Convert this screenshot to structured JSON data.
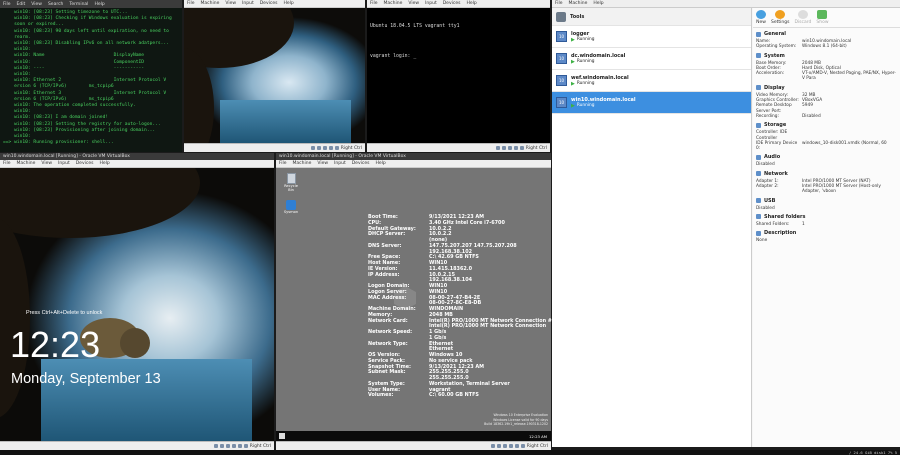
{
  "left_terminal": {
    "titlebar": "",
    "menu": [
      "File",
      "Edit",
      "View",
      "Search",
      "Terminal",
      "Help"
    ],
    "lines": [
      "    win10: [08:23] Setting timezone to UTC...",
      "    win10: [08:23] Checking if Windows evaluation is expiring",
      "    soon or expired...",
      "    win10: [08:23] 90 days left until expiration, no need to",
      "    rearm.",
      "    win10: [08:23] Disabling IPv6 on all network adatpers...",
      "    win10:",
      "    win10: Name                         DisplayName",
      "    win10:                              ComponentID",
      "    win10: ----                         -----------",
      "    win10:",
      "    win10: Ethernet 2                   Internet Protocol V",
      "    ersion 6 (TCP/IPv6)        ms_tcpip6",
      "    win10: Ethernet 3                   Internet Protocol V",
      "    ersion 6 (TCP/IPv6)        ms_tcpip6",
      "    win10: The operation completed successfully.",
      "    win10:",
      "    win10: [08:23] I am domain joined!",
      "    win10: [08:23] Setting the registry for auto-logon...",
      "    win10: [08:23] Provisioning after joining domain...",
      "    win10:",
      "==> win10: Running provisioner: shell..."
    ]
  },
  "top_vm1": {
    "menu": [
      "File",
      "Machine",
      "View",
      "Input",
      "Devices",
      "Help"
    ],
    "status": "Right Ctrl"
  },
  "top_vm2": {
    "menu": [
      "File",
      "Machine",
      "View",
      "Input",
      "Devices",
      "Help"
    ],
    "status": "Right Ctrl",
    "console": [
      "Ubuntu 18.04.5 LTS vagrant tty1",
      "",
      "vagrant login: _"
    ]
  },
  "bl_vm": {
    "titlebar": "win10.windomain.local [Running] - Oracle VM VirtualBox",
    "menu": [
      "File",
      "Machine",
      "View",
      "Input",
      "Devices",
      "Help"
    ],
    "unlock_hint": "Press Ctrl+Alt+Delete to unlock",
    "time": "12:23",
    "date": "Monday, September 13",
    "status": "Right Ctrl"
  },
  "bm_vm": {
    "titlebar": "win10.windomain.local [Running] - Oracle VM VirtualBox",
    "menu": [
      "File",
      "Machine",
      "View",
      "Input",
      "Devices",
      "Help"
    ],
    "status": "Right Ctrl",
    "desktop_icons": [
      "Recycle Bin",
      "Sysmon"
    ],
    "bginfo": [
      [
        "Boot Time:",
        "9/13/2021 12:23 AM"
      ],
      [
        "CPU:",
        "3.40 GHz Intel Core i7-6700"
      ],
      [
        "Default Gateway:",
        "10.0.2.2"
      ],
      [
        "DHCP Server:",
        "10.0.2.2"
      ],
      [
        "",
        "(none)"
      ],
      [
        "DNS Server:",
        "147.75.207.207 147.75.207.208"
      ],
      [
        "",
        "192.168.38.102"
      ],
      [
        "Free Space:",
        "C:\\ 42.69 GB NTFS"
      ],
      [
        "Host Name:",
        "WIN10"
      ],
      [
        "IE Version:",
        "11.415.18362.0"
      ],
      [
        "IP Address:",
        "10.0.2.15"
      ],
      [
        "",
        "192.168.38.104"
      ],
      [
        "Logon Domain:",
        "WIN10"
      ],
      [
        "Logon Server:",
        "WIN10"
      ],
      [
        "MAC Address:",
        "08-00-27-47-B4-2E"
      ],
      [
        "",
        "08-00-27-8C-E8-DB"
      ],
      [
        "Machine Domain:",
        "WINDOMAIN"
      ],
      [
        "Memory:",
        "2048 MB"
      ],
      [
        "Network Card:",
        "Intel(R) PRO/1000 MT Network Connection #2"
      ],
      [
        "",
        "Intel(R) PRO/1000 MT Network Connection"
      ],
      [
        "Network Speed:",
        "1 Gb/s"
      ],
      [
        "",
        "1 Gb/s"
      ],
      [
        "Network Type:",
        "Ethernet"
      ],
      [
        "",
        "Ethernet"
      ],
      [
        "OS Version:",
        "Windows 10"
      ],
      [
        "Service Pack:",
        "No service pack"
      ],
      [
        "Snapshot Time:",
        "9/13/2021 12:23 AM"
      ],
      [
        "Subnet Mask:",
        "255.255.255.0"
      ],
      [
        "",
        "255.255.255.0"
      ],
      [
        "System Type:",
        "Workstation, Terminal Server"
      ],
      [
        "User Name:",
        "vagrant"
      ],
      [
        "Volumes:",
        "C:\\ 60.00 GB NTFS"
      ]
    ],
    "watermark": [
      "Windows 10 Enterprise Evaluation",
      "Windows License valid for 90 days",
      "Build 18362.19h1_release.190318-1202"
    ],
    "tray_time": "12:23 AM"
  },
  "vbox": {
    "menu": [
      "File",
      "Machine",
      "Help"
    ],
    "tools_label": "Tools",
    "toolbar": [
      "New",
      "Settings",
      "Discard",
      "Show"
    ],
    "vms": [
      {
        "name": "logger",
        "state": "Running"
      },
      {
        "name": "dc.windomain.local",
        "state": "Running"
      },
      {
        "name": "wef.windomain.local",
        "state": "Running"
      },
      {
        "name": "win10.windomain.local",
        "state": "Running"
      }
    ],
    "sections": [
      {
        "title": "General",
        "rows": [
          [
            "Name:",
            "win10.windomain.local"
          ],
          [
            "Operating System:",
            "Windows 8.1 (64-bit)"
          ]
        ]
      },
      {
        "title": "System",
        "rows": [
          [
            "Base Memory:",
            "2048 MB"
          ],
          [
            "Boot Order:",
            "Hard Disk, Optical"
          ],
          [
            "Acceleration:",
            "VT-x/AMD-V, Nested Paging, PAE/NX, Hyper-V Para"
          ]
        ]
      },
      {
        "title": "Display",
        "rows": [
          [
            "Video Memory:",
            "32 MB"
          ],
          [
            "Graphics Controller:",
            "VBoxVGA"
          ],
          [
            "Remote Desktop Server Port:",
            "5949"
          ],
          [
            "Recording:",
            "Disabled"
          ]
        ]
      },
      {
        "title": "Storage",
        "rows": [
          [
            "Controller: IDE Controller",
            ""
          ],
          [
            "  IDE Primary Device 0:",
            "windows_10-disk001.vmdk (Normal, 60"
          ]
        ]
      },
      {
        "title": "Audio",
        "rows": [
          [
            "Disabled",
            ""
          ]
        ]
      },
      {
        "title": "Network",
        "rows": [
          [
            "Adapter 1:",
            "Intel PRO/1000 MT Server (NAT)"
          ],
          [
            "Adapter 2:",
            "Intel PRO/1000 MT Server (Host-only Adapter, 'vboxn"
          ]
        ]
      },
      {
        "title": "USB",
        "rows": [
          [
            "Disabled",
            ""
          ]
        ]
      },
      {
        "title": "Shared folders",
        "rows": [
          [
            "Shared Folders:",
            "1"
          ]
        ]
      },
      {
        "title": "Description",
        "rows": [
          [
            "None",
            ""
          ]
        ]
      }
    ]
  },
  "host_bar": {
    "right_text": "/ 24.6 GiB disk1 7% 5"
  }
}
